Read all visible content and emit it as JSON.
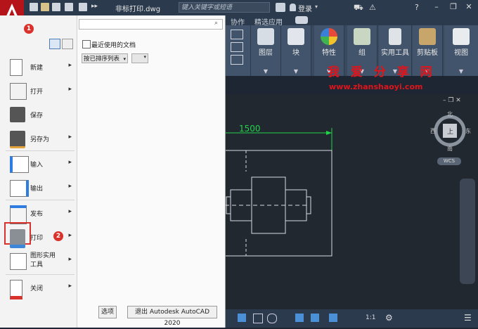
{
  "titlebar": {
    "document_title": "非标打印.dwg",
    "search_placeholder": "键入关键字或短语",
    "login": "登录"
  },
  "ribbon": {
    "tabs": [
      "协作",
      "精选应用"
    ],
    "groups": [
      {
        "label": "图层",
        "icon": "layer-icon"
      },
      {
        "label": "块",
        "icon": "block-icon"
      },
      {
        "label": "特性",
        "icon": "properties-icon"
      },
      {
        "label": "组",
        "icon": "group-icon"
      },
      {
        "label": "实用工具",
        "icon": "calculator-icon"
      },
      {
        "label": "剪贴板",
        "icon": "clipboard-icon"
      },
      {
        "label": "视图",
        "icon": "view-icon"
      }
    ]
  },
  "watermark": {
    "line1": "我 爱 分 享 网",
    "line2": "www.zhanshaoyi.com"
  },
  "drawing": {
    "dimension": "1500",
    "viewcube": {
      "north": "北",
      "west": "西",
      "east": "东",
      "south": "南",
      "top": "上",
      "wcs": "WCS"
    }
  },
  "status_bar": {
    "scale": "1:1"
  },
  "app_menu": {
    "items": [
      {
        "label": "新建",
        "arrow": "▸"
      },
      {
        "label": "打开",
        "arrow": "▸"
      },
      {
        "label": "保存",
        "arrow": ""
      },
      {
        "label": "另存为",
        "arrow": "▸"
      },
      {
        "label": "输入",
        "arrow": "▸"
      },
      {
        "label": "输出",
        "arrow": "▸"
      },
      {
        "label": "发布",
        "arrow": "▸"
      },
      {
        "label": "打印",
        "arrow": "▸"
      },
      {
        "label": "图形实用工具",
        "arrow": "▸"
      },
      {
        "label": "关闭",
        "arrow": "▸"
      }
    ],
    "recent_title": "最近使用的文档",
    "sort_option": "按已排序列表",
    "options_button": "选项",
    "exit_button": "退出 Autodesk AutoCAD 2020"
  },
  "badges": {
    "one": "1",
    "two": "2"
  },
  "colors": {
    "accent_red": "#d9312b",
    "dimension_green": "#22d34a",
    "watermark_red": "#e0141a"
  }
}
